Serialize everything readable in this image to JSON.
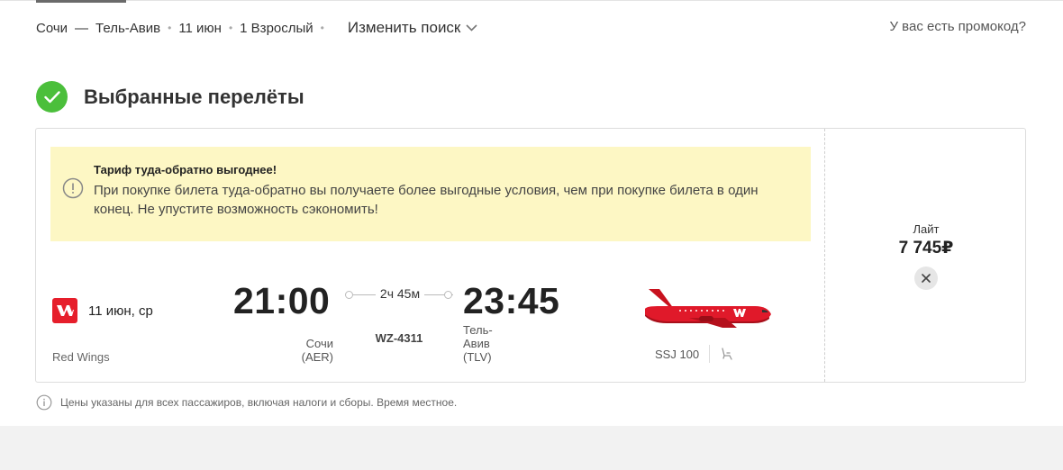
{
  "search": {
    "origin": "Сочи",
    "separator": "—",
    "destination": "Тель-Авив",
    "date": "11 июн",
    "passengers": "1 Взрослый",
    "change_label": "Изменить поиск",
    "promo_label": "У вас есть промокод?"
  },
  "section": {
    "title": "Выбранные перелёты",
    "status_color": "#4bbf3b"
  },
  "notice": {
    "title": "Тариф туда-обратно выгоднее!",
    "text": "При покупке билета туда-обратно вы получаете более выгодные условия, чем при покупке билета в один конец. Не упустите возможность сэкономить!",
    "background": "#fdf7c4"
  },
  "flight": {
    "date": "11 июн, ср",
    "airline": "Red Wings",
    "airline_color": "#e61e2b",
    "departure_time": "21:00",
    "departure_city": "Сочи",
    "departure_code": "(AER)",
    "arrival_time": "23:45",
    "arrival_city_line1": "Тель-",
    "arrival_city_line2": "Авив",
    "arrival_code": "(TLV)",
    "duration": "2ч 45м",
    "flight_number": "WZ-4311",
    "aircraft": "SSJ 100"
  },
  "fare": {
    "name": "Лайт",
    "price": "7 745₽"
  },
  "footnote": "Цены указаны для всех пассажиров, включая налоги и сборы. Время местное."
}
